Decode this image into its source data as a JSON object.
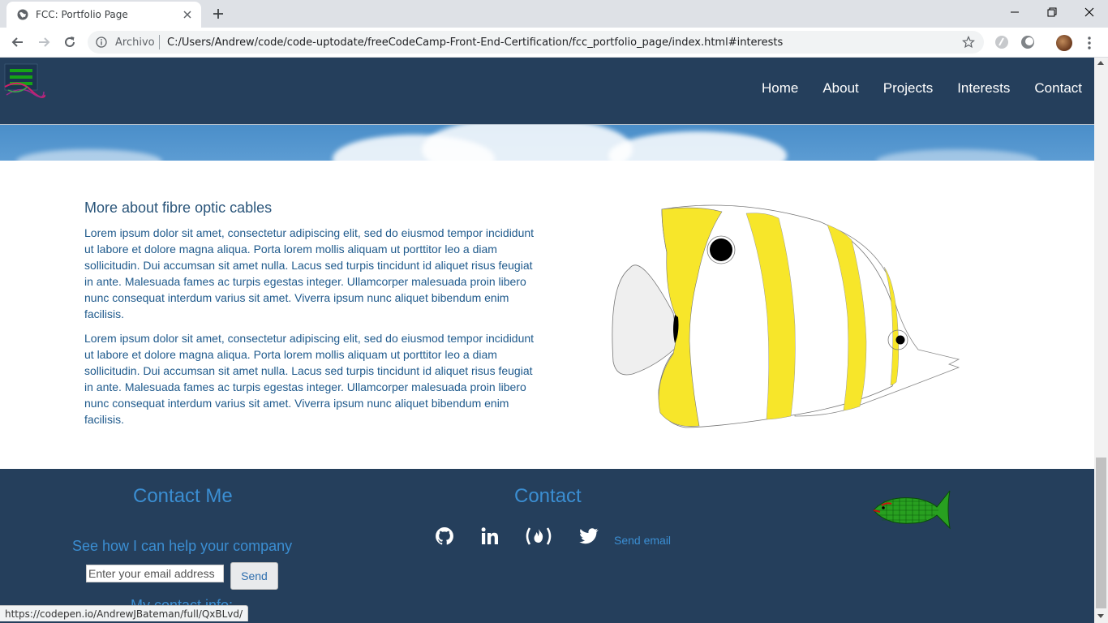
{
  "browser": {
    "tab_title": "FCC: Portfolio Page",
    "omnibox_scheme": "Archivo",
    "url": "C:/Users/Andrew/code/code-uptodate/freeCodeCamp-Front-End-Certification/fcc_portfolio_page/index.html#interests",
    "status_url": "https://codepen.io/AndrewJBateman/full/QxBLvd/"
  },
  "nav": {
    "items": [
      {
        "label": "Home"
      },
      {
        "label": "About"
      },
      {
        "label": "Projects"
      },
      {
        "label": "Interests"
      },
      {
        "label": "Contact"
      }
    ]
  },
  "content": {
    "title": "More about fibre optic cables",
    "paragraphs": [
      "Lorem ipsum dolor sit amet, consectetur adipiscing elit, sed do eiusmod tempor incididunt ut labore et dolore magna aliqua. Porta lorem mollis aliquam ut porttitor leo a diam sollicitudin. Dui accumsan sit amet nulla. Lacus sed turpis tincidunt id aliquet risus feugiat in ante. Malesuada fames ac turpis egestas integer. Ullamcorper malesuada proin libero nunc consequat interdum varius sit amet. Viverra ipsum nunc aliquet bibendum enim facilisis.",
      "Lorem ipsum dolor sit amet, consectetur adipiscing elit, sed do eiusmod tempor incididunt ut labore et dolore magna aliqua. Porta lorem mollis aliquam ut porttitor leo a diam sollicitudin. Dui accumsan sit amet nulla. Lacus sed turpis tincidunt id aliquet risus feugiat in ante. Malesuada fames ac turpis egestas integer. Ullamcorper malesuada proin libero nunc consequat interdum varius sit amet. Viverra ipsum nunc aliquet bibendum enim facilisis."
    ]
  },
  "footer": {
    "contact_me_title": "Contact Me",
    "help_text": "See how I can help your company",
    "email_placeholder": "Enter your email address",
    "send_label": "Send",
    "my_contact_info": "My contact info:",
    "contact_title": "Contact",
    "send_email_label": "Send email",
    "social_icons": [
      "github-icon",
      "linkedin-icon",
      "freecodecamp-icon",
      "twitter-icon"
    ]
  },
  "colors": {
    "nav_bg": "#253f5c",
    "footer_bg": "#253f5c",
    "accent_blue": "#3b8ed2",
    "text_blue": "#1f5a8c",
    "fish_yellow": "#f7e62a"
  }
}
